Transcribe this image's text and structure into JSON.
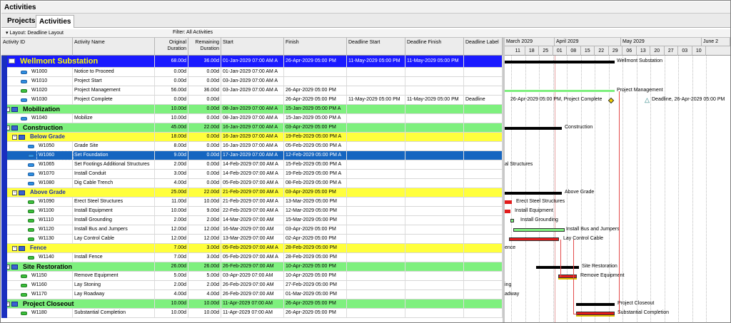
{
  "window": {
    "title": "Activities"
  },
  "tabs": [
    {
      "label": "Projects"
    },
    {
      "label": "Activities"
    }
  ],
  "toolbar": {
    "layout": "Layout: Deadline Layout",
    "filter": "Filter: All Activities"
  },
  "columns": {
    "id": "Activity ID",
    "name": "Activity Name",
    "orig": "Original Duration",
    "rem": "Remaining Duration",
    "start": "Start",
    "finish": "Finish",
    "dstart": "Deadline Start",
    "dfinish": "Deadline Finish",
    "dlabel": "Deadline Label"
  },
  "rows": [
    {
      "kind": "wbs1",
      "id": "",
      "name": "Wellmont Substation",
      "orig": "68.00d",
      "rem": "36.00d",
      "start": "01-Jan-2029 07:00 AM A",
      "finish": "26-Apr-2029 05:00 PM",
      "dstart": "11-May-2029 05:00 PM",
      "dfinish": "11-May-2029 05:00 PM",
      "dlabel": ""
    },
    {
      "kind": "act",
      "icon": "milestone",
      "id": "W1000",
      "name": "Notice to Proceed",
      "orig": "0.00d",
      "rem": "0.00d",
      "start": "01-Jan-2029 07:00 AM A",
      "finish": "",
      "dstart": "",
      "dfinish": "",
      "dlabel": ""
    },
    {
      "kind": "act",
      "icon": "milestone",
      "id": "W1010",
      "name": "Project Start",
      "orig": "0.00d",
      "rem": "0.00d",
      "start": "03-Jan-2029 07:00 AM A",
      "finish": "",
      "dstart": "",
      "dfinish": "",
      "dlabel": ""
    },
    {
      "kind": "act",
      "icon": "green",
      "id": "W1020",
      "name": "Project Management",
      "orig": "56.00d",
      "rem": "36.00d",
      "start": "03-Jan-2029 07:00 AM A",
      "finish": "26-Apr-2029 05:00 PM",
      "dstart": "",
      "dfinish": "",
      "dlabel": ""
    },
    {
      "kind": "act",
      "icon": "milestone",
      "id": "W1030",
      "name": "Project Complete",
      "orig": "0.00d",
      "rem": "0.00d",
      "start": "",
      "finish": "26-Apr-2029 05:00 PM",
      "dstart": "11-May-2029 05:00 PM",
      "dfinish": "11-May-2029 05:00 PM",
      "dlabel": "Deadline"
    },
    {
      "kind": "wbs2",
      "id": "",
      "name": "Mobilization",
      "orig": "10.00d",
      "rem": "0.00d",
      "start": "08-Jan-2029 07:00 AM A",
      "finish": "15-Jan-2029 05:00 PM A",
      "dstart": "",
      "dfinish": "",
      "dlabel": ""
    },
    {
      "kind": "act",
      "icon": "blue",
      "id": "W1040",
      "name": "Mobilize",
      "orig": "10.00d",
      "rem": "0.00d",
      "start": "08-Jan-2029 07:00 AM A",
      "finish": "15-Jan-2029 05:00 PM A",
      "dstart": "",
      "dfinish": "",
      "dlabel": ""
    },
    {
      "kind": "wbs2",
      "id": "",
      "name": "Construction",
      "orig": "45.00d",
      "rem": "22.00d",
      "start": "16-Jan-2029 07:00 AM A",
      "finish": "03-Apr-2029 05:00 PM",
      "dstart": "",
      "dfinish": "",
      "dlabel": ""
    },
    {
      "kind": "wbs3",
      "id": "",
      "name": "Below Grade",
      "orig": "18.00d",
      "rem": "0.00d",
      "start": "16-Jan-2029 07:00 AM A",
      "finish": "19-Feb-2029 05:00 PM A",
      "dstart": "",
      "dfinish": "",
      "dlabel": ""
    },
    {
      "kind": "act",
      "icon": "blue",
      "id": "W1050",
      "name": "Grade Site",
      "orig": "8.00d",
      "rem": "0.00d",
      "start": "16-Jan-2029 07:00 AM A",
      "finish": "05-Feb-2029 05:00 PM A",
      "dstart": "",
      "dfinish": "",
      "dlabel": ""
    },
    {
      "kind": "act",
      "icon": "blue",
      "id": "W1060",
      "name": "Set Foundation",
      "orig": "9.00d",
      "rem": "0.00d",
      "start": "17-Jan-2029 07:00 AM A",
      "finish": "12-Feb-2029 05:00 PM A",
      "dstart": "",
      "dfinish": "",
      "dlabel": "",
      "selected": true
    },
    {
      "kind": "act",
      "icon": "blue",
      "id": "W1065",
      "name": "Set Footings Additional Structures",
      "orig": "2.00d",
      "rem": "0.00d",
      "start": "14-Feb-2029 07:00 AM A",
      "finish": "15-Feb-2029 05:00 PM A",
      "dstart": "",
      "dfinish": "",
      "dlabel": ""
    },
    {
      "kind": "act",
      "icon": "blue",
      "id": "W1070",
      "name": "Install Conduit",
      "orig": "3.00d",
      "rem": "0.00d",
      "start": "14-Feb-2029 07:00 AM A",
      "finish": "19-Feb-2029 05:00 PM A",
      "dstart": "",
      "dfinish": "",
      "dlabel": ""
    },
    {
      "kind": "act",
      "icon": "blue",
      "id": "W1080",
      "name": "Dig Cable Trench",
      "orig": "4.00d",
      "rem": "0.00d",
      "start": "05-Feb-2029 07:00 AM A",
      "finish": "08-Feb-2029 05:00 PM A",
      "dstart": "",
      "dfinish": "",
      "dlabel": ""
    },
    {
      "kind": "wbs3",
      "id": "",
      "name": "Above Grade",
      "orig": "25.00d",
      "rem": "22.00d",
      "start": "21-Feb-2029 07:00 AM A",
      "finish": "03-Apr-2029 05:00 PM",
      "dstart": "",
      "dfinish": "",
      "dlabel": ""
    },
    {
      "kind": "act",
      "icon": "green",
      "id": "W1090",
      "name": "Erect Steel Structures",
      "orig": "11.00d",
      "rem": "10.00d",
      "start": "21-Feb-2029 07:00 AM A",
      "finish": "13-Mar-2029 05:00 PM",
      "dstart": "",
      "dfinish": "",
      "dlabel": ""
    },
    {
      "kind": "act",
      "icon": "green",
      "id": "W1100",
      "name": "Install Equipment",
      "orig": "10.00d",
      "rem": "9.00d",
      "start": "22-Feb-2029 07:00 AM A",
      "finish": "12-Mar-2029 05:00 PM",
      "dstart": "",
      "dfinish": "",
      "dlabel": ""
    },
    {
      "kind": "act",
      "icon": "green",
      "id": "W1110",
      "name": "Install Grounding",
      "orig": "2.00d",
      "rem": "2.00d",
      "start": "14-Mar-2029 07:00 AM",
      "finish": "15-Mar-2029 05:00 PM",
      "dstart": "",
      "dfinish": "",
      "dlabel": ""
    },
    {
      "kind": "act",
      "icon": "green",
      "id": "W1120",
      "name": "Install Bus and Jumpers",
      "orig": "12.00d",
      "rem": "12.00d",
      "start": "16-Mar-2029 07:00 AM",
      "finish": "03-Apr-2029 05:00 PM",
      "dstart": "",
      "dfinish": "",
      "dlabel": ""
    },
    {
      "kind": "act",
      "icon": "green",
      "id": "W1130",
      "name": "Lay Control Cable",
      "orig": "12.00d",
      "rem": "12.00d",
      "start": "13-Mar-2029 07:00 AM",
      "finish": "02-Apr-2029 05:00 PM",
      "dstart": "",
      "dfinish": "",
      "dlabel": ""
    },
    {
      "kind": "wbs3",
      "id": "",
      "name": "Fence",
      "orig": "7.00d",
      "rem": "3.00d",
      "start": "05-Feb-2029 07:00 AM A",
      "finish": "28-Feb-2029 05:00 PM",
      "dstart": "",
      "dfinish": "",
      "dlabel": ""
    },
    {
      "kind": "act",
      "icon": "green",
      "id": "W1140",
      "name": "Install Fence",
      "orig": "7.00d",
      "rem": "3.00d",
      "start": "05-Feb-2029 07:00 AM A",
      "finish": "28-Feb-2029 05:00 PM",
      "dstart": "",
      "dfinish": "",
      "dlabel": ""
    },
    {
      "kind": "wbs2",
      "id": "",
      "name": "Site Restoration",
      "orig": "26.00d",
      "rem": "26.00d",
      "start": "26-Feb-2029 07:00 AM",
      "finish": "10-Apr-2029 05:00 PM",
      "dstart": "",
      "dfinish": "",
      "dlabel": ""
    },
    {
      "kind": "act",
      "icon": "green",
      "id": "W1150",
      "name": "Remove Equipment",
      "orig": "5.00d",
      "rem": "5.00d",
      "start": "03-Apr-2029 07:00 AM",
      "finish": "10-Apr-2029 05:00 PM",
      "dstart": "",
      "dfinish": "",
      "dlabel": ""
    },
    {
      "kind": "act",
      "icon": "green",
      "id": "W1160",
      "name": "Lay Stoning",
      "orig": "2.00d",
      "rem": "2.00d",
      "start": "26-Feb-2029 07:00 AM",
      "finish": "27-Feb-2029 05:00 PM",
      "dstart": "",
      "dfinish": "",
      "dlabel": ""
    },
    {
      "kind": "act",
      "icon": "green",
      "id": "W1170",
      "name": "Lay Roadway",
      "orig": "4.00d",
      "rem": "4.00d",
      "start": "26-Feb-2029 07:00 AM",
      "finish": "01-Mar-2029 05:00 PM",
      "dstart": "",
      "dfinish": "",
      "dlabel": ""
    },
    {
      "kind": "wbs2",
      "id": "",
      "name": "Project Closeout",
      "orig": "10.00d",
      "rem": "10.00d",
      "start": "11-Apr-2029 07:00 AM",
      "finish": "26-Apr-2029 05:00 PM",
      "dstart": "",
      "dfinish": "",
      "dlabel": ""
    },
    {
      "kind": "act",
      "icon": "green",
      "id": "W1180",
      "name": "Substantial Completion",
      "orig": "10.00d",
      "rem": "10.00d",
      "start": "11-Apr-2029 07:00 AM",
      "finish": "26-Apr-2029 05:00 PM",
      "dstart": "",
      "dfinish": "",
      "dlabel": ""
    }
  ],
  "gantt": {
    "months": [
      "March 2029",
      "April 2029",
      "May 2029",
      "June 2"
    ],
    "weeks": [
      "11",
      "18",
      "25",
      "01",
      "08",
      "15",
      "22",
      "29",
      "06",
      "13",
      "20",
      "27",
      "03",
      "10"
    ],
    "labels": {
      "wellmont": "Wellmont Substation",
      "pm": "Project Management",
      "complete": "26-Apr-2029 05:00 PM, Project Complete",
      "deadline": "Deadline, 26-Apr-2029 05:00 PM",
      "construction": "Construction",
      "footings": "al Structures",
      "above": "Above Grade",
      "steel": "Erect Steel Structures",
      "equip": "Install Equipment",
      "ground": "Install Grounding",
      "bus": "Install Bus and Jumpers",
      "cable": "Lay Control Cable",
      "fence": "ence",
      "restoration": "Site Restoration",
      "remove": "Remove Equipment",
      "stoning": "ing",
      "roadway": "adway",
      "closeout": "Project Closeout",
      "substantial": "Substantial Completion"
    }
  },
  "colors": {
    "wbs1": "#1a1aff",
    "wbs2": "#7ef07e",
    "wbs3": "#ffff3c",
    "selected": "#1565c0",
    "critical": "#e31b1b",
    "remaining": "#7ef07e",
    "baseline": "#e6c000"
  }
}
